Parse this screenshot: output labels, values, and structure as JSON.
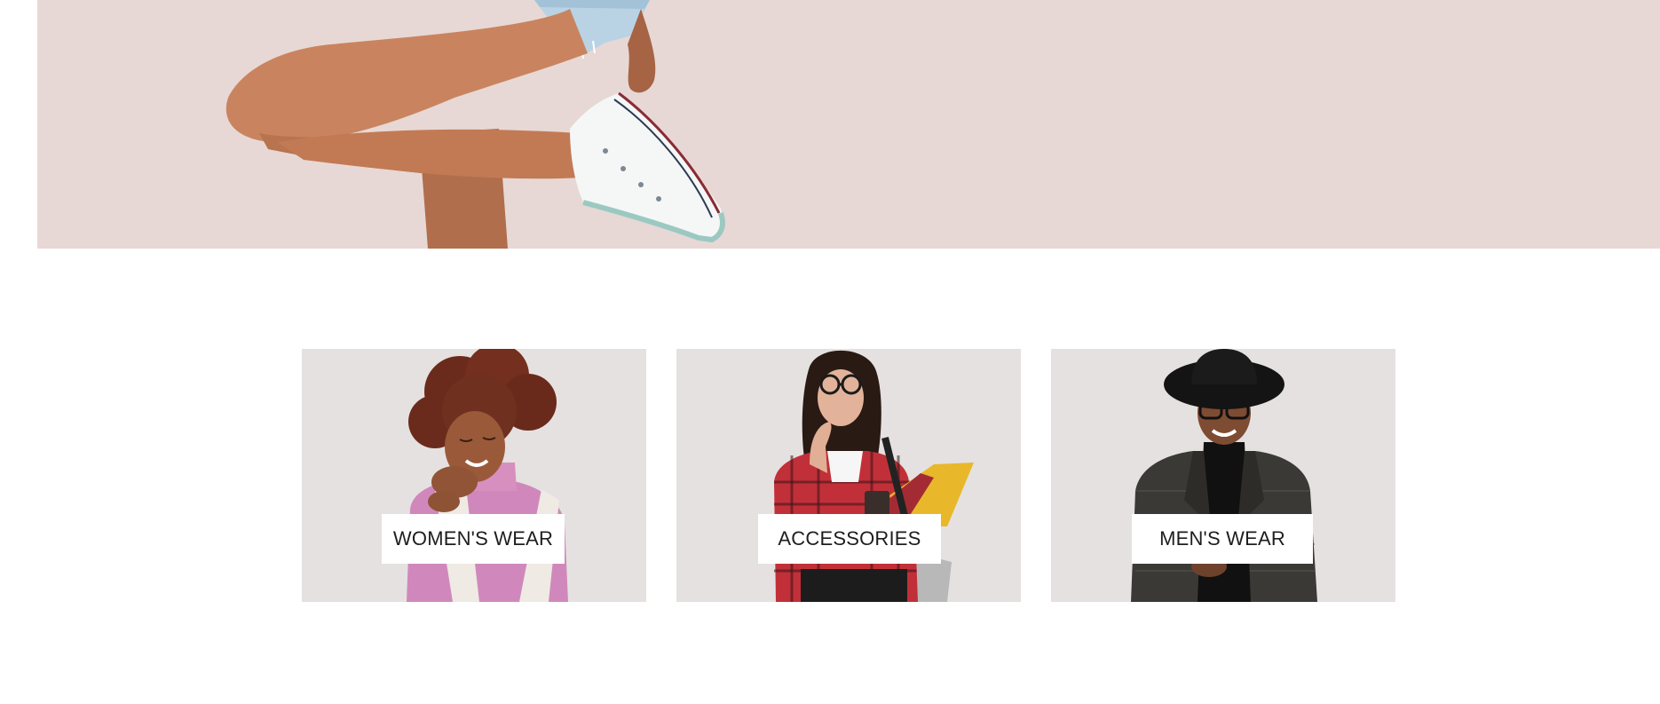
{
  "hero": {
    "image": "sneaker-leg-photo",
    "background_color": "#e7d8d5"
  },
  "categories": [
    {
      "label": "WOMEN'S WEAR",
      "image": "woman-curly-hair-pink-sweater-photo"
    },
    {
      "label": "ACCESSORIES",
      "image": "woman-glasses-plaid-shirt-folders-photo"
    },
    {
      "label": "MEN'S WEAR",
      "image": "man-hat-blazer-glasses-photo"
    }
  ],
  "colors": {
    "card_background": "#e5e1e0",
    "label_background": "#ffffff",
    "label_text": "#1e1e1e"
  }
}
